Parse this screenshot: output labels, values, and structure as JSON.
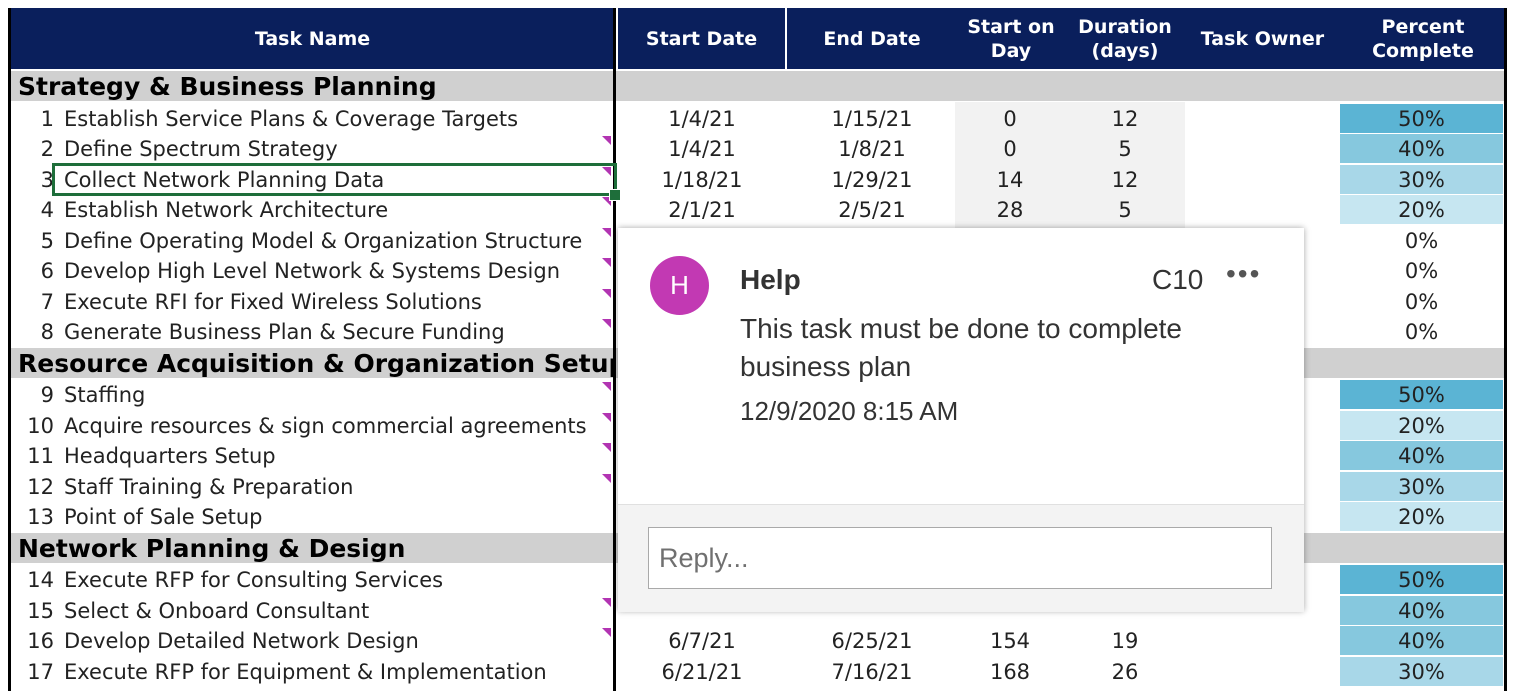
{
  "headers": {
    "task_name": "Task Name",
    "start_date": "Start Date",
    "end_date": "End Date",
    "start_on_day": "Start on\nDay",
    "duration": "Duration\n(days)",
    "task_owner": "Task Owner",
    "percent_complete": "Percent\nComplete"
  },
  "sections": [
    {
      "label": "Strategy & Business Planning"
    },
    {
      "label": "Resource Acquisition & Organization Setup"
    },
    {
      "label": "Network Planning & Design"
    }
  ],
  "rows": [
    {
      "num": "1",
      "task": "Establish Service Plans & Coverage Targets",
      "start": "1/4/21",
      "end": "1/15/21",
      "day": "0",
      "dur": "12",
      "pct": "50%",
      "pct_value": 50
    },
    {
      "num": "2",
      "task": "Define Spectrum Strategy",
      "start": "1/4/21",
      "end": "1/8/21",
      "day": "0",
      "dur": "5",
      "pct": "40%",
      "pct_value": 40
    },
    {
      "num": "3",
      "task": "Collect Network Planning Data",
      "start": "1/18/21",
      "end": "1/29/21",
      "day": "14",
      "dur": "12",
      "pct": "30%",
      "pct_value": 30
    },
    {
      "num": "4",
      "task": "Establish Network Architecture",
      "start": "2/1/21",
      "end": "2/5/21",
      "day": "28",
      "dur": "5",
      "pct": "20%",
      "pct_value": 20
    },
    {
      "num": "5",
      "task": "Define Operating Model & Organization Structure",
      "start": "",
      "end": "",
      "day": "",
      "dur": "",
      "pct": "0%",
      "pct_value": 0
    },
    {
      "num": "6",
      "task": "Develop High Level Network & Systems Design",
      "start": "",
      "end": "",
      "day": "",
      "dur": "",
      "pct": "0%",
      "pct_value": 0
    },
    {
      "num": "7",
      "task": "Execute RFI for Fixed Wireless Solutions",
      "start": "",
      "end": "",
      "day": "",
      "dur": "",
      "pct": "0%",
      "pct_value": 0
    },
    {
      "num": "8",
      "task": "Generate Business Plan & Secure Funding",
      "start": "",
      "end": "",
      "day": "",
      "dur": "",
      "pct": "0%",
      "pct_value": 0
    },
    {
      "num": "9",
      "task": "Staffing",
      "start": "",
      "end": "",
      "day": "",
      "dur": "",
      "pct": "50%",
      "pct_value": 50
    },
    {
      "num": "10",
      "task": "Acquire resources & sign commercial agreements",
      "start": "",
      "end": "",
      "day": "",
      "dur": "",
      "pct": "20%",
      "pct_value": 20
    },
    {
      "num": "11",
      "task": "Headquarters Setup",
      "start": "",
      "end": "",
      "day": "",
      "dur": "",
      "pct": "40%",
      "pct_value": 40
    },
    {
      "num": "12",
      "task": "Staff Training & Preparation",
      "start": "",
      "end": "",
      "day": "",
      "dur": "",
      "pct": "30%",
      "pct_value": 30
    },
    {
      "num": "13",
      "task": "Point of Sale Setup",
      "start": "",
      "end": "",
      "day": "",
      "dur": "",
      "pct": "20%",
      "pct_value": 20
    },
    {
      "num": "14",
      "task": "Execute RFP for Consulting Services",
      "start": "",
      "end": "",
      "day": "",
      "dur": "",
      "pct": "50%",
      "pct_value": 50
    },
    {
      "num": "15",
      "task": "Select & Onboard Consultant",
      "start": "",
      "end": "",
      "day": "",
      "dur": "",
      "pct": "40%",
      "pct_value": 40
    },
    {
      "num": "16",
      "task": "Develop Detailed Network Design",
      "start": "6/7/21",
      "end": "6/25/21",
      "day": "154",
      "dur": "19",
      "pct": "40%",
      "pct_value": 40
    },
    {
      "num": "17",
      "task": "Execute RFP for Equipment & Implementation",
      "start": "6/21/21",
      "end": "7/16/21",
      "day": "168",
      "dur": "26",
      "pct": "30%",
      "pct_value": 30
    }
  ],
  "comment": {
    "avatar_initial": "H",
    "author": "Help",
    "cell_ref": "C10",
    "more_label": "•••",
    "text": "This task must be done to complete business plan",
    "timestamp": "12/9/2020 8:15 AM",
    "reply_placeholder": "Reply..."
  },
  "colors": {
    "header_bg": "#0a1f5c",
    "section_bg": "#d0d0d0",
    "pct_50": "#5bb4d4",
    "pct_40": "#86c8de",
    "pct_30": "#a8d7e8",
    "pct_20": "#c6e6f1",
    "avatar": "#c239b3",
    "selection": "#1e6e3a",
    "comment_marker": "#b234b2"
  }
}
